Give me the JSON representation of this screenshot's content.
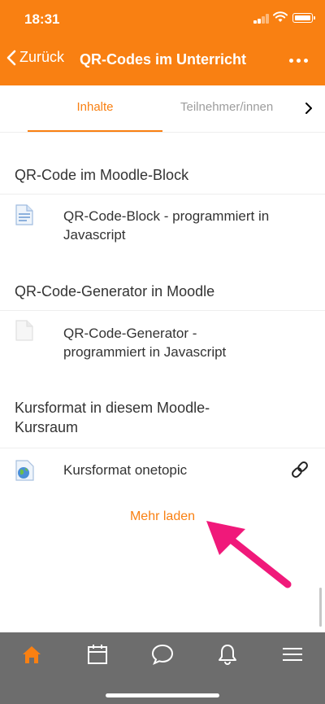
{
  "status_bar": {
    "time": "18:31"
  },
  "nav": {
    "back_label": "Zurück",
    "title": "QR-Codes im Unterricht"
  },
  "tabs": [
    {
      "label": "Inhalte",
      "active": true
    },
    {
      "label": "Teilnehmer/innen",
      "active": false
    }
  ],
  "sections": [
    {
      "title": "QR-Code im Moodle-Block",
      "activities": [
        {
          "label": "QR-Code-Block - programmiert in Javascript",
          "icon": "page-icon"
        }
      ]
    },
    {
      "title": "QR-Code-Generator in Moodle",
      "activities": [
        {
          "label": "QR-Code-Generator - programmiert in Javascript",
          "icon": "page-icon"
        }
      ]
    },
    {
      "title": "Kursformat in diesem Moodle-Kursraum",
      "activities": [
        {
          "label": "Kursformat onetopic",
          "icon": "url-globe-icon",
          "action_icon": "link-icon"
        }
      ]
    }
  ],
  "load_more_label": "Mehr laden",
  "tabbar": [
    "home-icon",
    "calendar-icon",
    "messages-icon",
    "notifications-icon",
    "menu-icon"
  ],
  "colors": {
    "accent": "#f98012",
    "tabbar": "#6d6d6d",
    "annotation_arrow": "#f0197a"
  }
}
